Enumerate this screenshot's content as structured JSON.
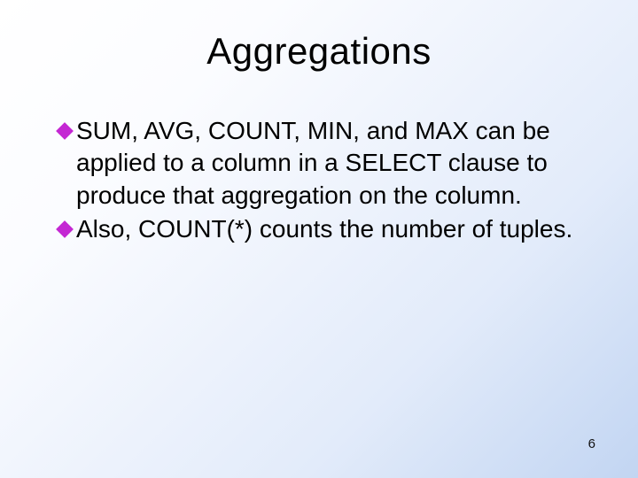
{
  "slide": {
    "title": "Aggregations",
    "bullets": [
      {
        "text": "SUM, AVG, COUNT, MIN, and MAX can be applied to a column in a SELECT clause to produce that aggregation on the column."
      },
      {
        "text": "Also, COUNT(*) counts the number of tuples."
      }
    ],
    "page_number": "6",
    "bullet_color": "#c427d3"
  }
}
